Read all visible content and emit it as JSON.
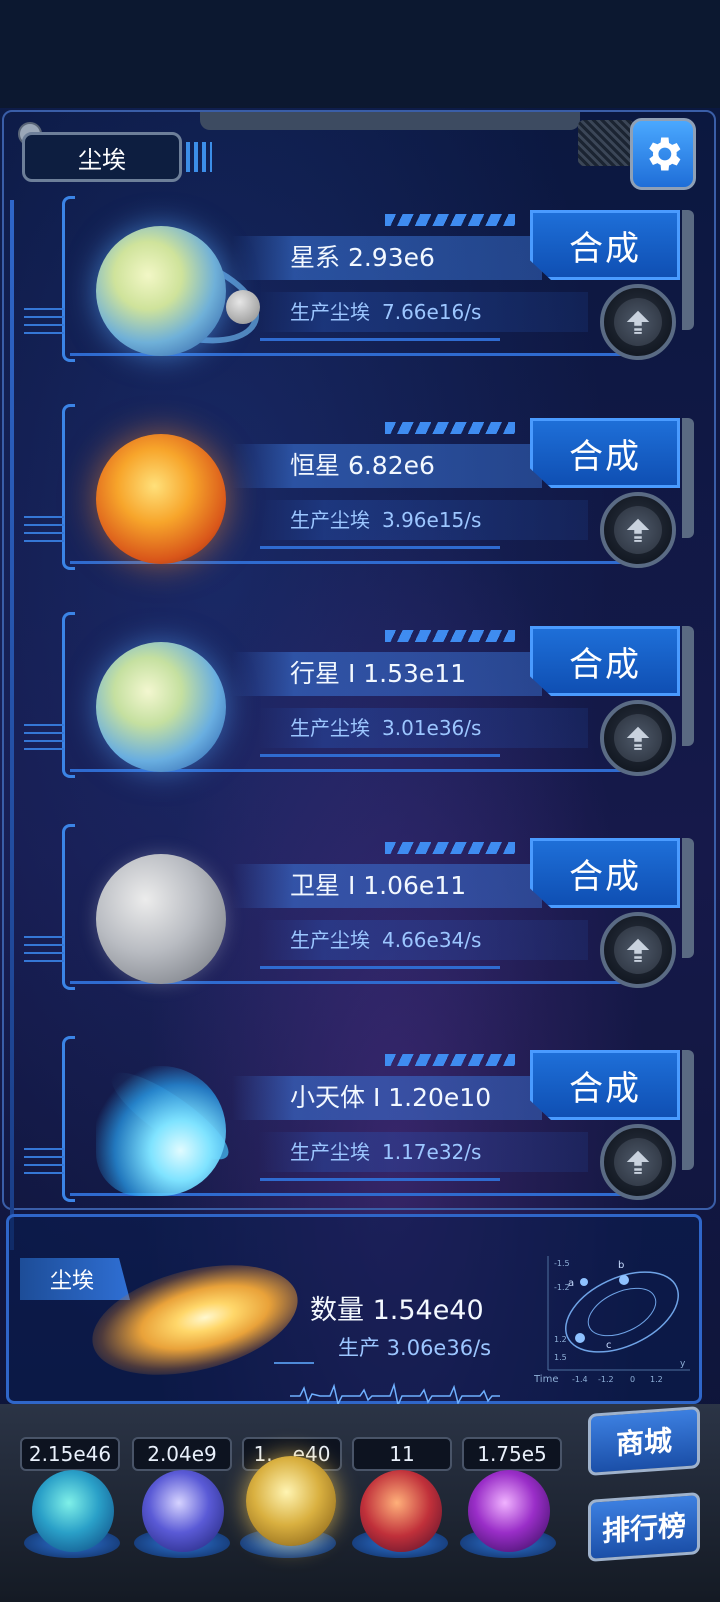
{
  "header": {
    "tab_label": "尘埃",
    "settings_icon": "gear-icon"
  },
  "rows": [
    {
      "name": "星系 2.93e6",
      "rate_label": "生产尘埃",
      "rate_value": "7.66e16/s",
      "synth_label": "合成"
    },
    {
      "name": "恒星 6.82e6",
      "rate_label": "生产尘埃",
      "rate_value": "3.96e15/s",
      "synth_label": "合成"
    },
    {
      "name": "行星 I 1.53e11",
      "rate_label": "生产尘埃",
      "rate_value": "3.01e36/s",
      "synth_label": "合成"
    },
    {
      "name": "卫星 I 1.06e11",
      "rate_label": "生产尘埃",
      "rate_value": "4.66e34/s",
      "synth_label": "合成"
    },
    {
      "name": "小天体 I 1.20e10",
      "rate_label": "生产尘埃",
      "rate_value": "1.17e32/s",
      "synth_label": "合成"
    }
  ],
  "dust": {
    "tag": "尘埃",
    "count": "数量 1.54e40",
    "production": "生产 3.06e36/s",
    "diagram": {
      "axis_label": "Time",
      "ticks_x": [
        "-1.4",
        "-1.2",
        "0",
        "1.2"
      ],
      "ticks_y": [
        "-1.5",
        "-1.2",
        "1.2",
        "1.5"
      ],
      "points": [
        "a",
        "b",
        "c"
      ],
      "y_label": "y"
    }
  },
  "bottom": {
    "resources": [
      "2.15e46",
      "2.04e9",
      "1.__e40",
      "11",
      "1.75e5"
    ],
    "shop_label": "商城",
    "rank_label": "排行榜"
  },
  "colors": {
    "accent": "#1e6fd8",
    "text_rate": "#9cc6ff",
    "frame": "#3b84e6"
  }
}
